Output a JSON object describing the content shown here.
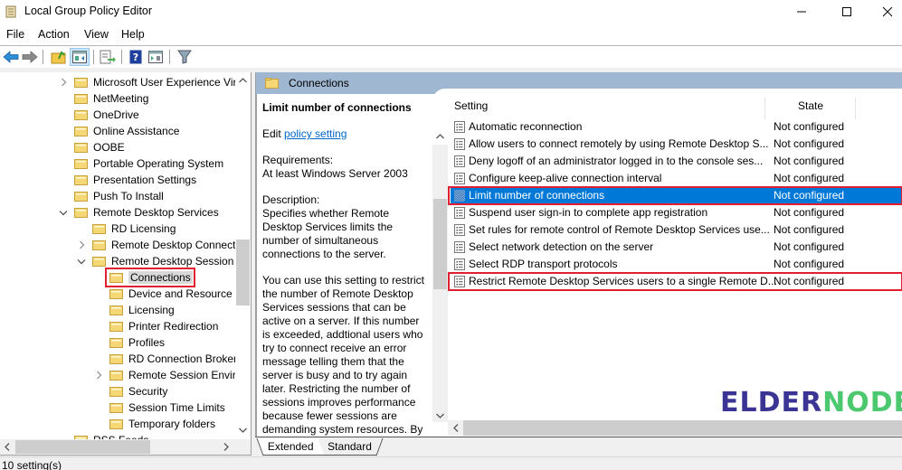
{
  "window": {
    "title": "Local Group Policy Editor",
    "controls": {
      "minimize": "minimize",
      "maximize": "maximize",
      "close": "close"
    }
  },
  "menu": [
    "File",
    "Action",
    "View",
    "Help"
  ],
  "toolbar": {
    "buttons": [
      {
        "name": "back-arrow-icon"
      },
      {
        "name": "forward-arrow-icon"
      },
      {
        "name": "up-folder-icon"
      },
      {
        "name": "show-hide-console-tree-icon",
        "active": true
      },
      {
        "name": "export-list-icon"
      },
      {
        "name": "help-icon"
      },
      {
        "name": "show-hide-action-pane-icon"
      },
      {
        "name": "filter-icon"
      }
    ]
  },
  "tree": {
    "items": [
      {
        "label": "Microsoft User Experience Virt",
        "level": 0,
        "expander": "collapsed"
      },
      {
        "label": "NetMeeting",
        "level": 0,
        "expander": "none"
      },
      {
        "label": "OneDrive",
        "level": 0,
        "expander": "none"
      },
      {
        "label": "Online Assistance",
        "level": 0,
        "expander": "none"
      },
      {
        "label": "OOBE",
        "level": 0,
        "expander": "none"
      },
      {
        "label": "Portable Operating System",
        "level": 0,
        "expander": "none"
      },
      {
        "label": "Presentation Settings",
        "level": 0,
        "expander": "none"
      },
      {
        "label": "Push To Install",
        "level": 0,
        "expander": "none"
      },
      {
        "label": "Remote Desktop Services",
        "level": 0,
        "expander": "expanded"
      },
      {
        "label": "RD Licensing",
        "level": 1,
        "expander": "none"
      },
      {
        "label": "Remote Desktop Connecti",
        "level": 1,
        "expander": "collapsed"
      },
      {
        "label": "Remote Desktop Session H",
        "level": 1,
        "expander": "expanded"
      },
      {
        "label": "Connections",
        "level": 2,
        "expander": "none",
        "selected": true
      },
      {
        "label": "Device and Resource Re",
        "level": 2,
        "expander": "none"
      },
      {
        "label": "Licensing",
        "level": 2,
        "expander": "none"
      },
      {
        "label": "Printer Redirection",
        "level": 2,
        "expander": "none"
      },
      {
        "label": "Profiles",
        "level": 2,
        "expander": "none"
      },
      {
        "label": "RD Connection Broker",
        "level": 2,
        "expander": "none"
      },
      {
        "label": "Remote Session Enviror",
        "level": 2,
        "expander": "collapsed"
      },
      {
        "label": "Security",
        "level": 2,
        "expander": "none"
      },
      {
        "label": "Session Time Limits",
        "level": 2,
        "expander": "none"
      },
      {
        "label": "Temporary folders",
        "level": 2,
        "expander": "none"
      },
      {
        "label": "RSS Feeds",
        "level": 0,
        "expander": "none"
      }
    ]
  },
  "right": {
    "header_title": "Connections",
    "description": {
      "policy_title": "Limit number of connections",
      "edit_prefix": "Edit",
      "edit_link": "policy setting",
      "requirements_label": "Requirements:",
      "requirements_value": "At least Windows Server 2003",
      "description_label": "Description:",
      "description_p1": "Specifies whether Remote Desktop Services limits the number of simultaneous connections to the server.",
      "description_p2": "You can use this setting to restrict the number of Remote Desktop Services sessions that can be active on a server. If this number is exceeded, addtional users who try to connect receive an error message telling them that the server is busy and to try again later. Restricting the number of sessions improves performance because fewer sessions are demanding system resources. By"
    },
    "columns": {
      "setting": "Setting",
      "state": "State"
    },
    "rows": [
      {
        "setting": "Automatic reconnection",
        "state": "Not configured"
      },
      {
        "setting": "Allow users to connect remotely by using Remote Desktop S...",
        "state": "Not configured"
      },
      {
        "setting": "Deny logoff of an administrator logged in to the console ses...",
        "state": "Not configured"
      },
      {
        "setting": "Configure keep-alive connection interval",
        "state": "Not configured"
      },
      {
        "setting": "Limit number of connections",
        "state": "Not configured",
        "selected": true,
        "highlighted": true
      },
      {
        "setting": "Suspend user sign-in to complete app registration",
        "state": "Not configured"
      },
      {
        "setting": "Set rules for remote control of Remote Desktop Services use...",
        "state": "Not configured"
      },
      {
        "setting": "Select network detection on the server",
        "state": "Not configured"
      },
      {
        "setting": "Select RDP transport protocols",
        "state": "Not configured"
      },
      {
        "setting": "Restrict Remote Desktop Services users to a single Remote D...",
        "state": "Not configured",
        "highlighted": true
      }
    ],
    "tabs": [
      "Extended",
      "Standard"
    ]
  },
  "status": {
    "text": "10 setting(s)"
  },
  "watermark": {
    "part1": "ELDER",
    "part2": "NODE",
    "color1": "#3b3494",
    "color2": "#4cc96f"
  },
  "colors": {
    "selection": "#0078d7",
    "highlight_outline": "#e02030",
    "header_bar": "#9fb7d0",
    "link": "#0066cc"
  }
}
